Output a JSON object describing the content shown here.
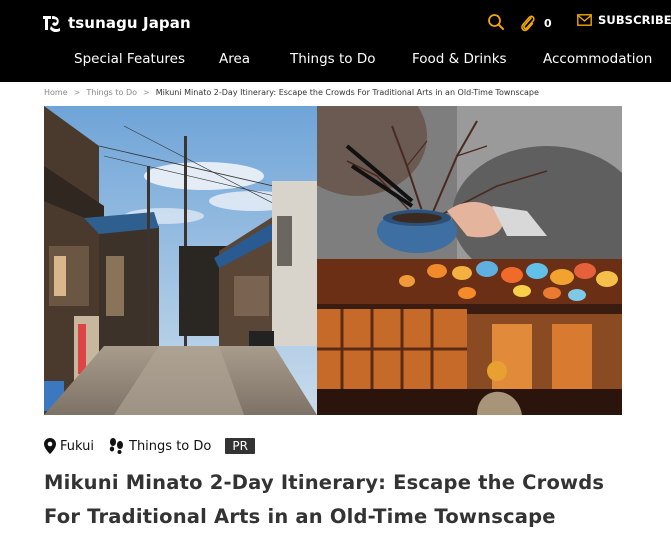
{
  "header": {
    "logo_text": "tsunagu Japan",
    "logo_icon": "tsunagu-logo-icon",
    "search_icon": "search-icon",
    "favorites_icon": "paperclip-icon",
    "favorites_count": "0",
    "subscribe_icon": "mail-icon",
    "subscribe_label": "SUBSCRIBE",
    "accent_color": "#f0a500"
  },
  "nav": {
    "items": [
      {
        "label": "Special Features"
      },
      {
        "label": "Area"
      },
      {
        "label": "Things to Do"
      },
      {
        "label": "Food & Drinks"
      },
      {
        "label": "Accommodation"
      }
    ]
  },
  "breadcrumb": {
    "items": [
      {
        "label": "Home"
      },
      {
        "label": "Things to Do"
      },
      {
        "label": "Mikuni Minato 2-Day Itinerary: Escape the Crowds For Traditional Arts in an Old-Time Townscape"
      }
    ],
    "separator": ">"
  },
  "article": {
    "location_tag": "Fukui",
    "category_tag": "Things to Do",
    "badge": "PR",
    "title": "Mikuni Minato 2-Day Itinerary: Escape the Crowds For Traditional Arts in an Old-Time Townscape"
  }
}
